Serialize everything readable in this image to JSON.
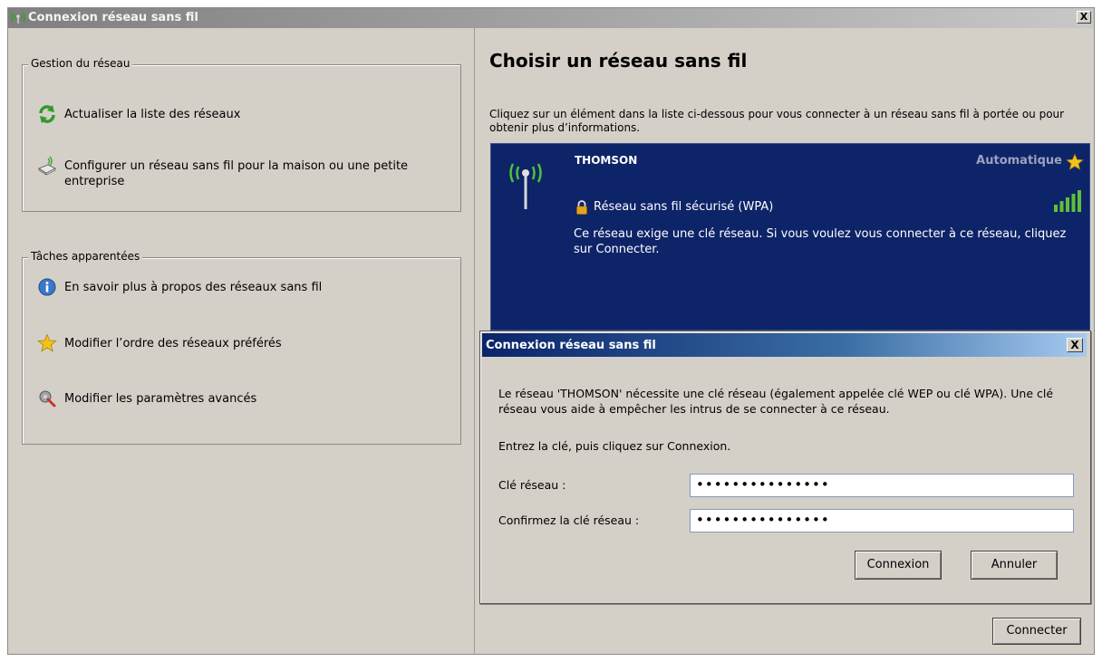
{
  "window": {
    "title": "Connexion réseau sans fil",
    "close_label": "X"
  },
  "left": {
    "network_group": {
      "legend": "Gestion du réseau",
      "items": [
        {
          "label": "Actualiser la liste des réseaux",
          "icon": "refresh-icon"
        },
        {
          "label": "Configurer un réseau sans fil pour la maison ou une petite entreprise",
          "icon": "network-setup-icon"
        }
      ]
    },
    "related_group": {
      "legend": "Tâches apparentées",
      "items": [
        {
          "label": "En savoir plus à propos des réseaux sans fil",
          "icon": "info-icon"
        },
        {
          "label": "Modifier l’ordre des réseaux préférés",
          "icon": "star-icon"
        },
        {
          "label": "Modifier les paramètres avancés",
          "icon": "settings-icon"
        }
      ]
    }
  },
  "right": {
    "heading": "Choisir un réseau sans fil",
    "intro": "Cliquez sur un élément dans la liste ci-dessous pour vous connecter à un réseau sans fil à portée ou pour obtenir plus d’informations.",
    "network": {
      "name": "THOMSON",
      "mode": "Automatique",
      "security": "Réseau sans fil sécurisé (WPA)",
      "signal_bars": 5,
      "description": "Ce réseau exige une clé réseau. Si vous voulez vous connecter à ce réseau, cliquez sur Connecter."
    },
    "connect_button": "Connecter"
  },
  "dialog": {
    "title": "Connexion réseau sans fil",
    "close_label": "X",
    "message": "Le réseau 'THOMSON' nécessite une clé réseau (également appelée clé WEP ou clé WPA). Une clé réseau vous aide à empêcher les intrus de se connecter à ce réseau.",
    "instruction": "Entrez la clé, puis cliquez sur Connexion.",
    "key_label": "Clé réseau :",
    "key_value": "•••••••••••••••",
    "confirm_label": "Confirmez la clé réseau :",
    "confirm_value": "•••••••••••••••",
    "connect_button": "Connexion",
    "cancel_button": "Annuler"
  },
  "colors": {
    "window_bg": "#d4d0c8",
    "network_panel_bg": "#0e2468",
    "dialog_title_bg": "#0a246a",
    "signal": "#5fbf3a",
    "star": "#f2c21b"
  }
}
